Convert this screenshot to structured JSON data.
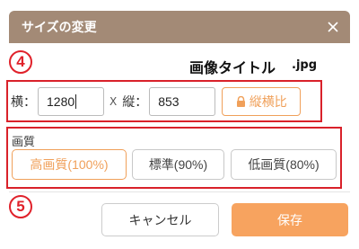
{
  "dialog": {
    "title": "サイズの変更",
    "close_icon": "close-icon"
  },
  "annotations": {
    "step4": "4",
    "step5": "5"
  },
  "file": {
    "title": "画像タイトル",
    "extension": ".jpg"
  },
  "size": {
    "width_label": "横：",
    "width_value": "1280",
    "separator": "X",
    "height_label": "縦：",
    "height_value": "853",
    "aspect_label": "縦横比",
    "aspect_icon": "lock-icon"
  },
  "quality": {
    "label": "画質",
    "options": [
      {
        "label": "高画質(100%)",
        "active": true
      },
      {
        "label": "標準(90%)",
        "active": false
      },
      {
        "label": "低画質(80%)",
        "active": false
      }
    ]
  },
  "footer": {
    "cancel_label": "キャンセル",
    "save_label": "保存"
  },
  "colors": {
    "titlebar": "#a38a76",
    "accent": "#f7a35f",
    "annotation_red": "#e0212a"
  }
}
